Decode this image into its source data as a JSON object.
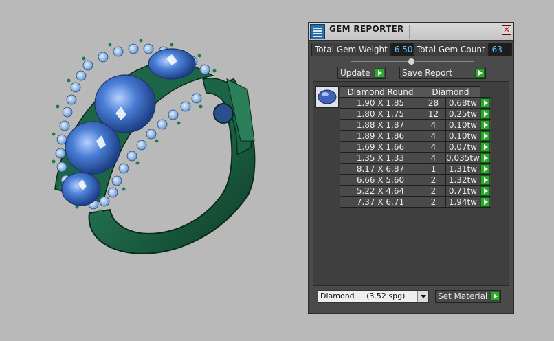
{
  "window": {
    "title": "GEM REPORTER",
    "close_label": "✕"
  },
  "stats": {
    "total_weight_label": "Total Gem Weight",
    "total_weight_value": "6.50",
    "total_count_label": "Total Gem Count",
    "total_count_value": "63"
  },
  "buttons": {
    "update": "Update",
    "save_report": "Save Report",
    "set_material": "Set Material"
  },
  "table": {
    "headers": [
      "Diamond Round",
      "Diamond"
    ],
    "rows": [
      {
        "size": "1.90 X 1.85",
        "count": "28",
        "weight": "0.68tw"
      },
      {
        "size": "1.80 X 1.75",
        "count": "12",
        "weight": "0.25tw"
      },
      {
        "size": "1.88 X 1.87",
        "count": "4",
        "weight": "0.10tw"
      },
      {
        "size": "1.89 X 1.86",
        "count": "4",
        "weight": "0.10tw"
      },
      {
        "size": "1.69 X 1.66",
        "count": "4",
        "weight": "0.07tw"
      },
      {
        "size": "1.35 X 1.33",
        "count": "4",
        "weight": "0.035tw"
      },
      {
        "size": "8.17 X 6.87",
        "count": "1",
        "weight": "1.31tw"
      },
      {
        "size": "6.66 X 5.60",
        "count": "2",
        "weight": "1.32tw"
      },
      {
        "size": "5.22 X 4.64",
        "count": "2",
        "weight": "0.71tw"
      },
      {
        "size": "7.37 X 6.71",
        "count": "2",
        "weight": "1.94tw"
      }
    ]
  },
  "material_select": {
    "value": "Diamond     (3.52 spg)"
  },
  "colors": {
    "accent_value": "#5fc3ff",
    "go_button": "#2fa82f",
    "ring_metal": "#1f6b4a",
    "gem_blue": "#3f73c8"
  }
}
